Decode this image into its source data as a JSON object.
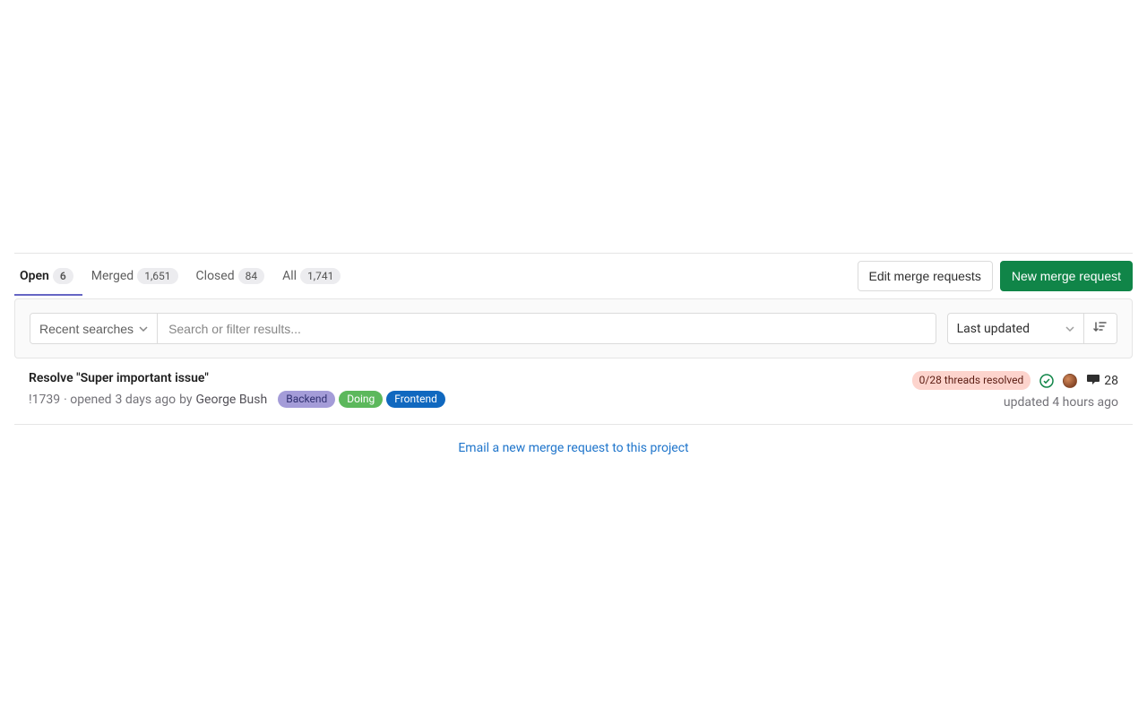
{
  "tabs": [
    {
      "label": "Open",
      "count": "6",
      "active": true
    },
    {
      "label": "Merged",
      "count": "1,651",
      "active": false
    },
    {
      "label": "Closed",
      "count": "84",
      "active": false
    },
    {
      "label": "All",
      "count": "1,741",
      "active": false
    }
  ],
  "actions": {
    "edit": "Edit merge requests",
    "new": "New merge request"
  },
  "filter": {
    "recent_label": "Recent searches",
    "search_placeholder": "Search or filter results...",
    "sort_label": "Last updated"
  },
  "mr": {
    "title": "Resolve \"Super important issue\"",
    "ref": "!1739",
    "opened_prefix": " · opened ",
    "opened_time": "3 days ago",
    "by": " by ",
    "author": "George Bush",
    "labels": [
      {
        "text": "Backend",
        "bg": "#a49cd8",
        "fg": "#2e2e6e"
      },
      {
        "text": "Doing",
        "bg": "#5cb85c",
        "fg": "#ffffff"
      },
      {
        "text": "Frontend",
        "bg": "#1068bf",
        "fg": "#ffffff"
      }
    ],
    "threads": "0/28 threads resolved",
    "comments": "28",
    "updated_prefix": "updated ",
    "updated_time": "4 hours ago"
  },
  "email_link": "Email a new merge request to this project"
}
